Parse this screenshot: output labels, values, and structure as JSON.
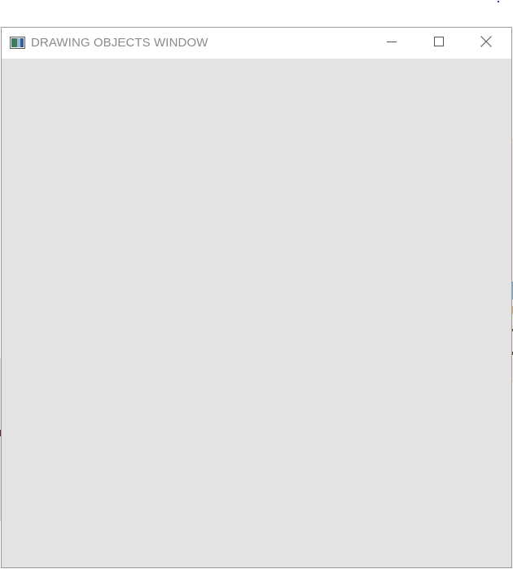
{
  "window": {
    "title": "DRAWING OBJECTS WINDOW",
    "icon": "app-window-icon",
    "controls": {
      "minimize_icon": "minimize-icon",
      "maximize_icon": "maximize-icon",
      "close_icon": "close-icon"
    }
  },
  "colors": {
    "titlebar": "#ffffff",
    "title_text": "#8a8a8a",
    "client_area": "#e3e3e3",
    "border": "#9a9a9a"
  }
}
